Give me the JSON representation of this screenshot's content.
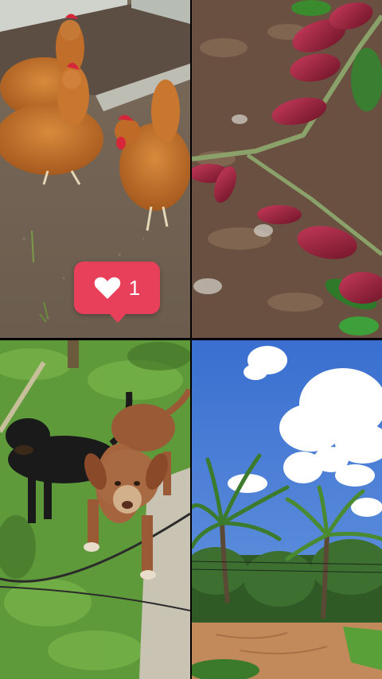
{
  "notification": {
    "icon": "heart-icon",
    "count": "1",
    "color": "#e8405a"
  },
  "tiles": [
    {
      "id": "chickens",
      "subject": "chickens"
    },
    {
      "id": "cacao",
      "subject": "cacao-pods"
    },
    {
      "id": "dogs",
      "subject": "dogs"
    },
    {
      "id": "sky",
      "subject": "palm-trees-sky"
    }
  ]
}
